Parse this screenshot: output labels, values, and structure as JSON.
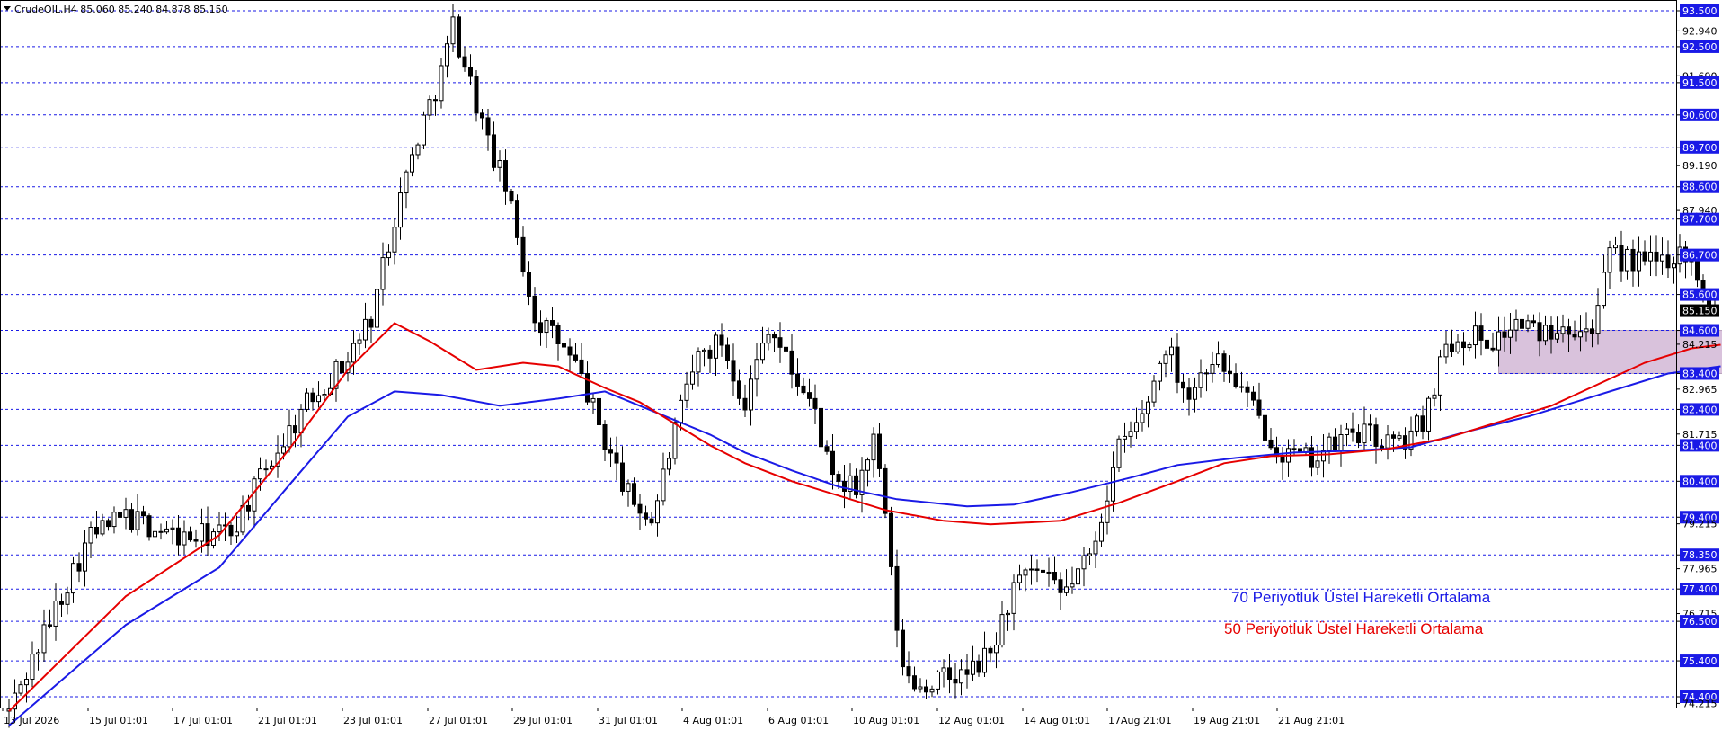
{
  "window": {
    "info_line": "CrudeOIL,H4  85.060 85.240 84.878 85.150"
  },
  "chart_data": {
    "type": "candlestick",
    "symbol": "CrudeOIL",
    "timeframe": "H4",
    "ohlc_header": {
      "open": 85.06,
      "high": 85.24,
      "low": 84.878,
      "close": 85.15
    },
    "current_price": "85.150",
    "ylim": [
      74.1,
      93.8
    ],
    "y_ticks": [
      {
        "label": "93.500",
        "value": 93.5,
        "boxed": true
      },
      {
        "label": "92.940",
        "value": 92.94,
        "boxed": false
      },
      {
        "label": "92.500",
        "value": 92.5,
        "boxed": true
      },
      {
        "label": "91.690",
        "value": 91.69,
        "boxed": false
      },
      {
        "label": "91.500",
        "value": 91.5,
        "boxed": true
      },
      {
        "label": "90.600",
        "value": 90.6,
        "boxed": true
      },
      {
        "label": "89.700",
        "value": 89.7,
        "boxed": true
      },
      {
        "label": "89.190",
        "value": 89.19,
        "boxed": false
      },
      {
        "label": "88.600",
        "value": 88.6,
        "boxed": true
      },
      {
        "label": "87.940",
        "value": 87.94,
        "boxed": false
      },
      {
        "label": "87.700",
        "value": 87.7,
        "boxed": true
      },
      {
        "label": "86.700",
        "value": 86.7,
        "boxed": true
      },
      {
        "label": "85.600",
        "value": 85.6,
        "boxed": true
      },
      {
        "label": "84.600",
        "value": 84.6,
        "boxed": true
      },
      {
        "label": "84.215",
        "value": 84.215,
        "boxed": false
      },
      {
        "label": "83.400",
        "value": 83.4,
        "boxed": true
      },
      {
        "label": "82.965",
        "value": 82.965,
        "boxed": false
      },
      {
        "label": "82.400",
        "value": 82.4,
        "boxed": true
      },
      {
        "label": "81.715",
        "value": 81.715,
        "boxed": false
      },
      {
        "label": "81.400",
        "value": 81.4,
        "boxed": true
      },
      {
        "label": "80.400",
        "value": 80.4,
        "boxed": true
      },
      {
        "label": "79.400",
        "value": 79.4,
        "boxed": true
      },
      {
        "label": "79.215",
        "value": 79.215,
        "boxed": false
      },
      {
        "label": "78.350",
        "value": 78.35,
        "boxed": true
      },
      {
        "label": "77.965",
        "value": 77.965,
        "boxed": false
      },
      {
        "label": "77.400",
        "value": 77.4,
        "boxed": true
      },
      {
        "label": "76.715",
        "value": 76.715,
        "boxed": false
      },
      {
        "label": "76.500",
        "value": 76.5,
        "boxed": true
      },
      {
        "label": "75.400",
        "value": 75.4,
        "boxed": true
      },
      {
        "label": "74.400",
        "value": 74.4,
        "boxed": true
      },
      {
        "label": "74.215",
        "value": 74.215,
        "boxed": false
      }
    ],
    "horizontal_levels": [
      93.5,
      92.5,
      91.5,
      90.6,
      89.7,
      88.6,
      87.7,
      86.7,
      85.6,
      84.6,
      83.4,
      82.4,
      81.4,
      80.4,
      79.4,
      78.35,
      77.4,
      76.5,
      75.4,
      74.4
    ],
    "x_labels": [
      "13 Jul 2026",
      "15 Jul 01:01",
      "17 Jul 01:01",
      "21 Jul 01:01",
      "23 Jul 01:01",
      "27 Jul 01:01",
      "29 Jul 01:01",
      "31 Jul 01:01",
      "4 Aug 01:01",
      "6 Aug 01:01",
      "10 Aug 01:01",
      "12 Aug 01:01",
      "14 Aug 01:01",
      "17Aug 21:01",
      "19 Aug 21:01",
      "21 Aug 21:01"
    ],
    "zone": {
      "price_top": 84.6,
      "price_bottom": 83.4,
      "color": "#d9c2dc"
    },
    "series_colors": {
      "ema70": "#1a1ae6",
      "ema50": "#e60000",
      "levels": "#1a1ae6",
      "candle": "#000000"
    },
    "legend": [
      {
        "label": "70 Periyotluk Üstel Hareketli Ortalama",
        "color": "#1a1ae6"
      },
      {
        "label": "50 Periyotluk Üstel Hareketli Ortalama",
        "color": "#e60000"
      }
    ],
    "trend_path": [
      [
        0,
        74.0
      ],
      [
        10,
        77.6
      ],
      [
        14,
        78.9
      ],
      [
        20,
        79.4
      ],
      [
        30,
        78.8
      ],
      [
        38,
        79.0
      ],
      [
        46,
        81.3
      ],
      [
        52,
        82.8
      ],
      [
        58,
        83.8
      ],
      [
        62,
        85.0
      ],
      [
        66,
        87.8
      ],
      [
        70,
        90.0
      ],
      [
        74,
        91.8
      ],
      [
        76,
        93.1
      ],
      [
        79,
        91.5
      ],
      [
        82,
        89.8
      ],
      [
        85,
        88.6
      ],
      [
        90,
        85.0
      ],
      [
        94,
        84.3
      ],
      [
        98,
        83.3
      ],
      [
        102,
        81.5
      ],
      [
        106,
        80.0
      ],
      [
        110,
        79.3
      ],
      [
        114,
        81.8
      ],
      [
        118,
        83.9
      ],
      [
        122,
        84.3
      ],
      [
        126,
        82.6
      ],
      [
        130,
        84.8
      ],
      [
        134,
        83.5
      ],
      [
        138,
        82.3
      ],
      [
        141,
        80.3
      ],
      [
        145,
        80.2
      ],
      [
        148,
        81.5
      ],
      [
        150,
        79.5
      ],
      [
        151,
        77.7
      ],
      [
        153,
        75.1
      ],
      [
        156,
        74.7
      ],
      [
        160,
        74.9
      ],
      [
        164,
        75.0
      ],
      [
        168,
        75.6
      ],
      [
        172,
        77.4
      ],
      [
        176,
        77.9
      ],
      [
        180,
        77.2
      ],
      [
        185,
        78.3
      ],
      [
        190,
        81.3
      ],
      [
        194,
        82.2
      ],
      [
        198,
        84.2
      ],
      [
        202,
        82.8
      ],
      [
        206,
        83.9
      ],
      [
        210,
        83.2
      ],
      [
        214,
        82.1
      ],
      [
        218,
        81.2
      ],
      [
        222,
        81.0
      ],
      [
        226,
        81.3
      ],
      [
        230,
        81.8
      ],
      [
        234,
        81.6
      ],
      [
        238,
        81.4
      ],
      [
        242,
        82.1
      ],
      [
        246,
        84.2
      ],
      [
        250,
        84.5
      ],
      [
        254,
        84.3
      ],
      [
        258,
        84.8
      ],
      [
        262,
        84.5
      ],
      [
        266,
        84.9
      ],
      [
        270,
        84.6
      ],
      [
        272,
        85.1
      ],
      [
        274,
        86.7
      ],
      [
        278,
        86.5
      ],
      [
        282,
        86.5
      ],
      [
        286,
        86.8
      ],
      [
        288,
        86.6
      ],
      [
        290,
        85.8
      ],
      [
        292,
        85.15
      ]
    ],
    "ema50": [
      [
        0,
        74.0
      ],
      [
        20,
        77.2
      ],
      [
        36,
        78.9
      ],
      [
        48,
        81.3
      ],
      [
        58,
        83.5
      ],
      [
        66,
        84.8
      ],
      [
        72,
        84.3
      ],
      [
        80,
        83.5
      ],
      [
        88,
        83.7
      ],
      [
        94,
        83.6
      ],
      [
        102,
        83.0
      ],
      [
        108,
        82.6
      ],
      [
        114,
        82.0
      ],
      [
        120,
        81.4
      ],
      [
        126,
        80.9
      ],
      [
        134,
        80.4
      ],
      [
        142,
        80.0
      ],
      [
        150,
        79.6
      ],
      [
        160,
        79.3
      ],
      [
        168,
        79.2
      ],
      [
        180,
        79.3
      ],
      [
        190,
        79.8
      ],
      [
        200,
        80.4
      ],
      [
        208,
        80.9
      ],
      [
        216,
        81.1
      ],
      [
        226,
        81.15
      ],
      [
        236,
        81.3
      ],
      [
        246,
        81.6
      ],
      [
        256,
        82.1
      ],
      [
        264,
        82.5
      ],
      [
        272,
        83.1
      ],
      [
        280,
        83.7
      ],
      [
        288,
        84.1
      ],
      [
        293,
        84.2
      ]
    ],
    "ema70": [
      [
        0,
        73.6
      ],
      [
        20,
        76.4
      ],
      [
        36,
        78.0
      ],
      [
        48,
        80.3
      ],
      [
        58,
        82.2
      ],
      [
        66,
        82.9
      ],
      [
        74,
        82.8
      ],
      [
        84,
        82.5
      ],
      [
        94,
        82.7
      ],
      [
        102,
        82.9
      ],
      [
        108,
        82.5
      ],
      [
        114,
        82.1
      ],
      [
        120,
        81.7
      ],
      [
        126,
        81.2
      ],
      [
        134,
        80.7
      ],
      [
        142,
        80.25
      ],
      [
        152,
        79.9
      ],
      [
        164,
        79.7
      ],
      [
        172,
        79.75
      ],
      [
        182,
        80.1
      ],
      [
        192,
        80.5
      ],
      [
        200,
        80.85
      ],
      [
        210,
        81.05
      ],
      [
        220,
        81.2
      ],
      [
        230,
        81.25
      ],
      [
        240,
        81.35
      ],
      [
        250,
        81.8
      ],
      [
        260,
        82.2
      ],
      [
        268,
        82.6
      ],
      [
        276,
        83.0
      ],
      [
        284,
        83.4
      ],
      [
        293,
        83.6
      ]
    ]
  }
}
